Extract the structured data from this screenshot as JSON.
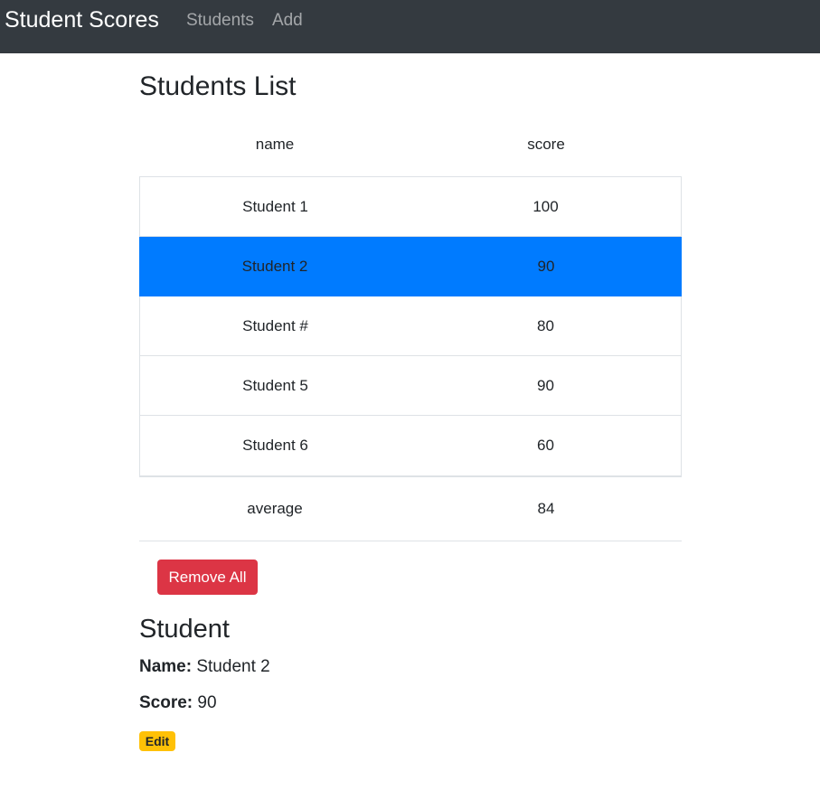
{
  "navbar": {
    "brand": "Student Scores",
    "links": [
      "Students",
      "Add"
    ]
  },
  "list": {
    "title": "Students List",
    "headers": {
      "name": "name",
      "score": "score"
    },
    "rows": [
      {
        "name": "Student 1",
        "score": "100"
      },
      {
        "name": "Student 2",
        "score": "90"
      },
      {
        "name": "Student #",
        "score": "80"
      },
      {
        "name": "Student 5",
        "score": "90"
      },
      {
        "name": "Student 6",
        "score": "60"
      }
    ],
    "selected_index": 1,
    "average": {
      "label": "average",
      "value": "84"
    },
    "remove_all_label": "Remove All"
  },
  "detail": {
    "title": "Student",
    "name_label": "Name:",
    "name_value": "Student 2",
    "score_label": "Score:",
    "score_value": "90",
    "edit_label": "Edit"
  },
  "colors": {
    "navbar": "#343a40",
    "active_row": "#007bff",
    "remove_button": "#dc3545",
    "edit_badge": "#ffc107"
  }
}
